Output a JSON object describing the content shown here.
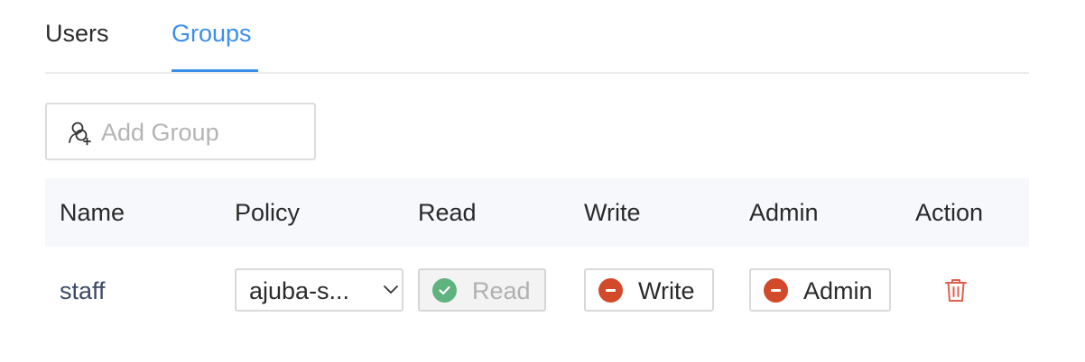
{
  "tabs": [
    {
      "label": "Users",
      "active": false
    },
    {
      "label": "Groups",
      "active": true
    }
  ],
  "add_group": {
    "label": "Add Group",
    "icon": "add-user-icon"
  },
  "table": {
    "columns": [
      "Name",
      "Policy",
      "Read",
      "Write",
      "Admin",
      "Action"
    ],
    "rows": [
      {
        "name": "staff",
        "policy": "ajuba-s...",
        "read": {
          "label": "Read",
          "state": "granted",
          "disabled": true,
          "icon": "check-circle-icon"
        },
        "write": {
          "label": "Write",
          "state": "denied",
          "icon": "minus-circle-icon"
        },
        "admin": {
          "label": "Admin",
          "state": "denied",
          "icon": "minus-circle-icon"
        },
        "action_icon": "trash-icon"
      }
    ]
  },
  "colors": {
    "accent": "#3b8eea",
    "granted": "#5fb37f",
    "denied": "#d34a2b",
    "delete": "#e0604f",
    "header_bg": "#f6f8fc"
  }
}
